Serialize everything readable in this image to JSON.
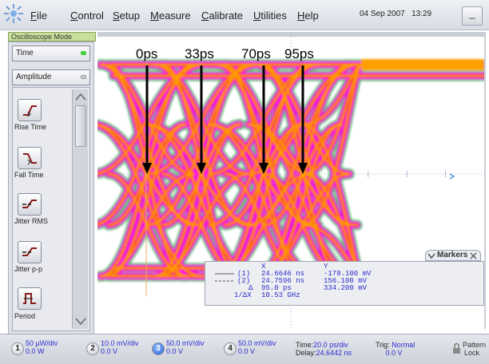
{
  "menu": {
    "items": [
      {
        "hot": "F",
        "rest": "ile"
      },
      {
        "hot": "C",
        "rest": "ontrol"
      },
      {
        "hot": "S",
        "rest": "etup"
      },
      {
        "hot": "M",
        "rest": "easure"
      },
      {
        "hot": "C",
        "rest": "alibrate"
      },
      {
        "hot": "U",
        "rest": "tilities"
      },
      {
        "hot": "H",
        "rest": "elp"
      }
    ],
    "date": "04 Sep 2007",
    "time": "13:29",
    "minimize": "_"
  },
  "mode_label": "Oscilloscope Mode",
  "sidebar": {
    "dropdown_time": "Time",
    "dropdown_amplitude": "Amplitude",
    "measurements": [
      {
        "label": "Rise Time",
        "icon": "rise-time-icon"
      },
      {
        "label": "Fall Time",
        "icon": "fall-time-icon"
      },
      {
        "label": "Jitter RMS",
        "icon": "jitter-rms-icon"
      },
      {
        "label": "Jitter p-p",
        "icon": "jitter-pp-icon"
      },
      {
        "label": "Period",
        "icon": "period-icon"
      }
    ]
  },
  "annotations": {
    "labels": [
      "0ps",
      "33ps",
      "70ps",
      "95ps"
    ]
  },
  "markers": {
    "title": "Markers",
    "col_x": "X",
    "col_y": "Y",
    "row1": {
      "marker": "(1)",
      "x": "24.6646 ns",
      "y": "-178.100 mV"
    },
    "row2": {
      "marker": "(2)",
      "x": "24.7596 ns",
      "y": "156.100 mV"
    },
    "delta": {
      "label": "Δ",
      "x": "95.0 ps",
      "y": "334.200 mV"
    },
    "inv_delta": {
      "label": "1/ΔX",
      "x": "10.53 GHz"
    }
  },
  "bottom": {
    "channels": [
      {
        "num": "1",
        "scale": "50 µW/div",
        "offset": "0.0 W"
      },
      {
        "num": "2",
        "scale": "10.0 mV/div",
        "offset": "0.0 V"
      },
      {
        "num": "3",
        "scale": "50.0 mV/div",
        "offset": "0.0 V"
      },
      {
        "num": "4",
        "scale": "50.0 mV/div",
        "offset": "0.0 V"
      }
    ],
    "time_label": "Time:",
    "time_value": "20.0 ps/div",
    "delay_label": "Delay:",
    "delay_value": "24.6442 ns",
    "trig_label": "Trig:",
    "trig_value": "Normal",
    "trig_level": "0.0 V",
    "pattern": "Pattern",
    "lock": "Lock"
  },
  "colors": {
    "accent": "#2c2cd0",
    "eye_outer": "#00b040",
    "eye_mid": "#ff00ff",
    "eye_inner": "#ff2a2a",
    "eye_core": "#ffa000"
  }
}
